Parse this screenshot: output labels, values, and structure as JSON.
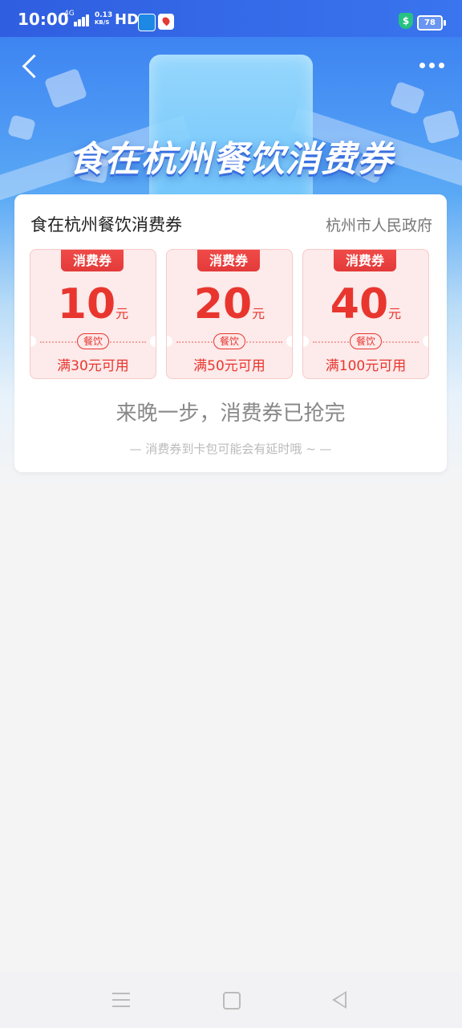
{
  "status": {
    "time": "10:00",
    "network": "4G",
    "speed_value": "0.13",
    "speed_unit": "KB/S",
    "hd": "HD",
    "battery": "78"
  },
  "banner": {
    "title": "食在杭州餐饮消费券"
  },
  "panel": {
    "title": "食在杭州餐饮消费券",
    "issuer": "杭州市人民政府",
    "coupons": [
      {
        "tag": "消费券",
        "amount": "10",
        "unit": "元",
        "category": "餐饮",
        "condition": "满30元可用"
      },
      {
        "tag": "消费券",
        "amount": "20",
        "unit": "元",
        "category": "餐饮",
        "condition": "满50元可用"
      },
      {
        "tag": "消费券",
        "amount": "40",
        "unit": "元",
        "category": "餐饮",
        "condition": "满100元可用"
      }
    ],
    "sold_out": "来晚一步，消费券已抢完",
    "tip": "— 消费券到卡包可能会有延时哦 ~ —"
  },
  "colors": {
    "accent": "#e8362f",
    "coupon_bg": "#fdeaea",
    "header_blue": "#3d84f2"
  },
  "icons": [
    "back-arrow-icon",
    "more-dots-icon",
    "signal-icon",
    "battery-icon",
    "shield-icon",
    "nav-menu-icon",
    "nav-home-icon",
    "nav-back-icon"
  ]
}
